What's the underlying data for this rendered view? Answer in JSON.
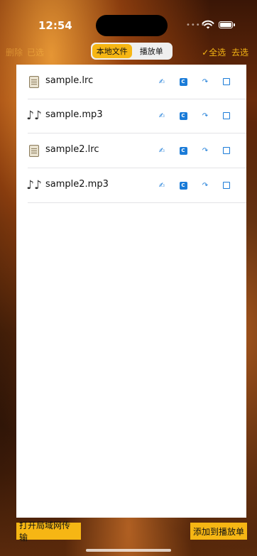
{
  "status_bar": {
    "time": "12:54"
  },
  "toolbar": {
    "left_actions": [
      "删除",
      "已选"
    ],
    "tabs": [
      {
        "label": "本地文件",
        "active": true
      },
      {
        "label": "播放单",
        "active": false
      }
    ],
    "select_all": "✓全选",
    "deselect": "去选"
  },
  "files": [
    {
      "name": "sample.lrc",
      "type": "lyrics",
      "icon": "document-icon"
    },
    {
      "name": "sample.mp3",
      "type": "audio",
      "icon": "music-note-icon"
    },
    {
      "name": "sample2.lrc",
      "type": "lyrics",
      "icon": "document-icon"
    },
    {
      "name": "sample2.mp3",
      "type": "audio",
      "icon": "music-note-icon"
    }
  ],
  "row_actions": [
    {
      "icon": "rename-icon",
      "glyph": "✍"
    },
    {
      "icon": "copy-badge-icon",
      "glyph": "C"
    },
    {
      "icon": "redo-icon",
      "glyph": "↷"
    },
    {
      "icon": "checkbox-icon",
      "glyph": ""
    }
  ],
  "bottom": {
    "lan_transfer": "打开局域网传输",
    "add_to_playlist": "添加到播放单"
  },
  "colors": {
    "accent": "#f6b614",
    "link_blue": "#1a7bd8"
  }
}
